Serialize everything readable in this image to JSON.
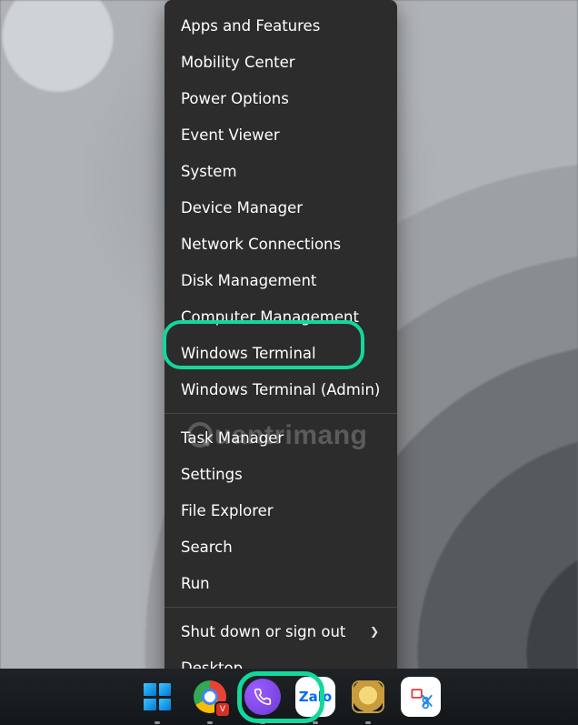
{
  "menu": {
    "group1": [
      {
        "id": "apps-features",
        "label": "Apps and Features"
      },
      {
        "id": "mobility-center",
        "label": "Mobility Center"
      },
      {
        "id": "power-options",
        "label": "Power Options"
      },
      {
        "id": "event-viewer",
        "label": "Event Viewer"
      },
      {
        "id": "system",
        "label": "System"
      },
      {
        "id": "device-manager",
        "label": "Device Manager"
      },
      {
        "id": "network-connections",
        "label": "Network Connections"
      },
      {
        "id": "disk-management",
        "label": "Disk Management"
      },
      {
        "id": "computer-management",
        "label": "Computer Management"
      },
      {
        "id": "windows-terminal",
        "label": "Windows Terminal",
        "highlighted": true
      },
      {
        "id": "windows-terminal-admin",
        "label": "Windows Terminal (Admin)"
      }
    ],
    "group2": [
      {
        "id": "task-manager",
        "label": "Task Manager"
      },
      {
        "id": "settings",
        "label": "Settings"
      },
      {
        "id": "file-explorer",
        "label": "File Explorer"
      },
      {
        "id": "search",
        "label": "Search"
      },
      {
        "id": "run",
        "label": "Run"
      }
    ],
    "group3": [
      {
        "id": "shut-down",
        "label": "Shut down or sign out",
        "submenu": true
      },
      {
        "id": "desktop",
        "label": "Desktop"
      }
    ]
  },
  "taskbar": {
    "items": [
      {
        "id": "start",
        "name": "Start",
        "highlighted": true
      },
      {
        "id": "chrome",
        "name": "Google Chrome",
        "badge": "V"
      },
      {
        "id": "viber",
        "name": "Viber"
      },
      {
        "id": "zalo",
        "name": "Zalo",
        "label": "Zalo"
      },
      {
        "id": "lol",
        "name": "League of Legends"
      },
      {
        "id": "snip",
        "name": "Snipping Tool"
      }
    ]
  },
  "watermark": "uantrimang",
  "colors": {
    "accent": "#13d89c"
  }
}
